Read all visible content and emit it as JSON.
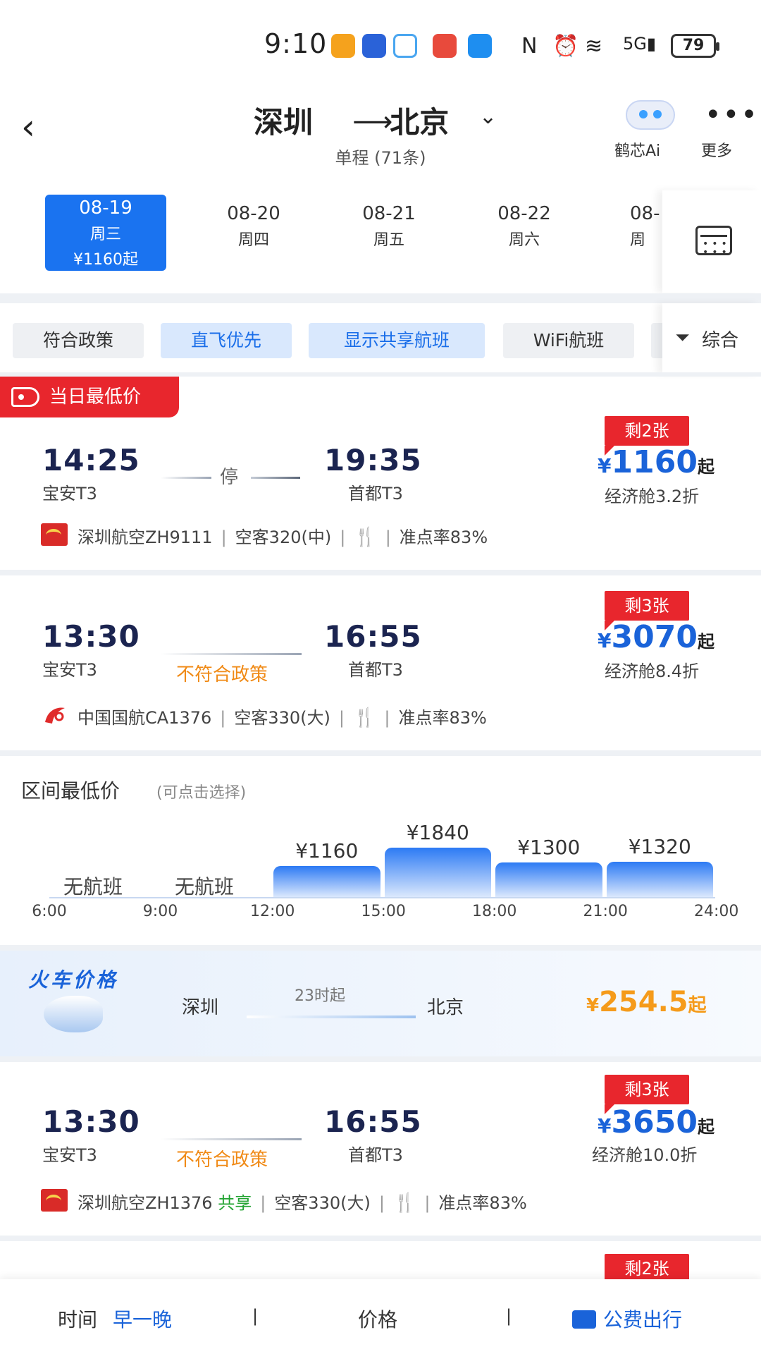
{
  "status_bar": {
    "time": "9:10",
    "battery": "79"
  },
  "header": {
    "origin": "深圳",
    "destination": "北京",
    "trip_summary": "单程 (71条)",
    "ai_label": "鹤芯Ai",
    "more_label": "更多"
  },
  "dates": [
    {
      "date": "08-19",
      "weekday": "周三",
      "price": "¥1160起",
      "active": true
    },
    {
      "date": "08-20",
      "weekday": "周四"
    },
    {
      "date": "08-21",
      "weekday": "周五"
    },
    {
      "date": "08-22",
      "weekday": "周六"
    },
    {
      "date": "08-",
      "weekday": "周"
    }
  ],
  "filters": [
    "符合政策",
    "直飞优先",
    "显示共享航班",
    "WiFi航班"
  ],
  "sort_label": "综合",
  "lowest_tag": "当日最低价",
  "flights": [
    {
      "dep_time": "14:25",
      "dep_airport": "宝安T3",
      "arr_time": "19:35",
      "arr_airport": "首都T3",
      "middle": "停",
      "remain": "剩2张",
      "currency": "¥",
      "price": "1160",
      "price_suffix": "起",
      "cabin": "经济舱3.2折",
      "airline": "深圳航空ZH9111",
      "shared": "",
      "aircraft": "空客320(中)",
      "ontime": "准点率83%"
    },
    {
      "dep_time": "13:30",
      "dep_airport": "宝安T3",
      "arr_time": "16:55",
      "arr_airport": "首都T3",
      "middle": "不符合政策",
      "remain": "剩3张",
      "currency": "¥",
      "price": "3070",
      "price_suffix": "起",
      "cabin": "经济舱8.4折",
      "airline": "中国国航CA1376",
      "shared": "",
      "aircraft": "空客330(大)",
      "ontime": "准点率83%"
    },
    {
      "dep_time": "13:30",
      "dep_airport": "宝安T3",
      "arr_time": "16:55",
      "arr_airport": "首都T3",
      "middle": "不符合政策",
      "remain": "剩3张",
      "currency": "¥",
      "price": "3650",
      "price_suffix": "起",
      "cabin": "经济舱10.0折",
      "airline": "深圳航空ZH1376",
      "shared": "共享",
      "aircraft": "空客330(大)",
      "ontime": "准点率83%"
    },
    {
      "remain": "剩2张"
    }
  ],
  "interval": {
    "title": "区间最低价",
    "subtitle": "(可点击选择)",
    "no_flight": "无航班",
    "ticks": [
      "6:00",
      "9:00",
      "12:00",
      "15:00",
      "18:00",
      "21:00",
      "24:00"
    ],
    "bars": [
      {
        "label": "¥1160",
        "value": 1160
      },
      {
        "label": "¥1840",
        "value": 1840
      },
      {
        "label": "¥1300",
        "value": 1300
      },
      {
        "label": "¥1320",
        "value": 1320
      }
    ]
  },
  "train": {
    "title": "火车价格",
    "from": "深圳",
    "to": "北京",
    "time": "23时起",
    "currency": "¥",
    "price": "254.5",
    "suffix": "起"
  },
  "bottom": {
    "time_label": "时间",
    "order_label": "早一晚",
    "sep": "|",
    "price_label": "价格",
    "business_label": "公费出行"
  },
  "colors": {
    "brand": "#1a73f0",
    "price": "#1a63d9",
    "alert": "#e8262d",
    "warning": "#f08a16",
    "train_price": "#f59b1b"
  }
}
